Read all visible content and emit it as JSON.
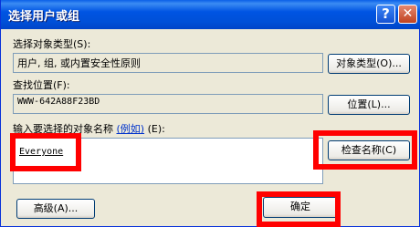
{
  "window": {
    "title": "选择用户或组",
    "help_icon": "?",
    "close_icon": "✕"
  },
  "object_type": {
    "label": "选择对象类型(S):",
    "value": "用户, 组, 或内置安全性原则",
    "button": "对象类型(O)..."
  },
  "location": {
    "label": "查找位置(F):",
    "value": "WWW-642A88F23BD",
    "button": "位置(L)..."
  },
  "names": {
    "label": "输入要选择的对象名称",
    "example_link": "(例如)",
    "label_suffix": "(E):",
    "value": "Everyone",
    "check_button": "检查名称(C)"
  },
  "footer": {
    "advanced_button": "高级(A)...",
    "ok_button": "确定"
  },
  "colors": {
    "highlight": "#ff0000",
    "title_blue": "#0054e3"
  }
}
